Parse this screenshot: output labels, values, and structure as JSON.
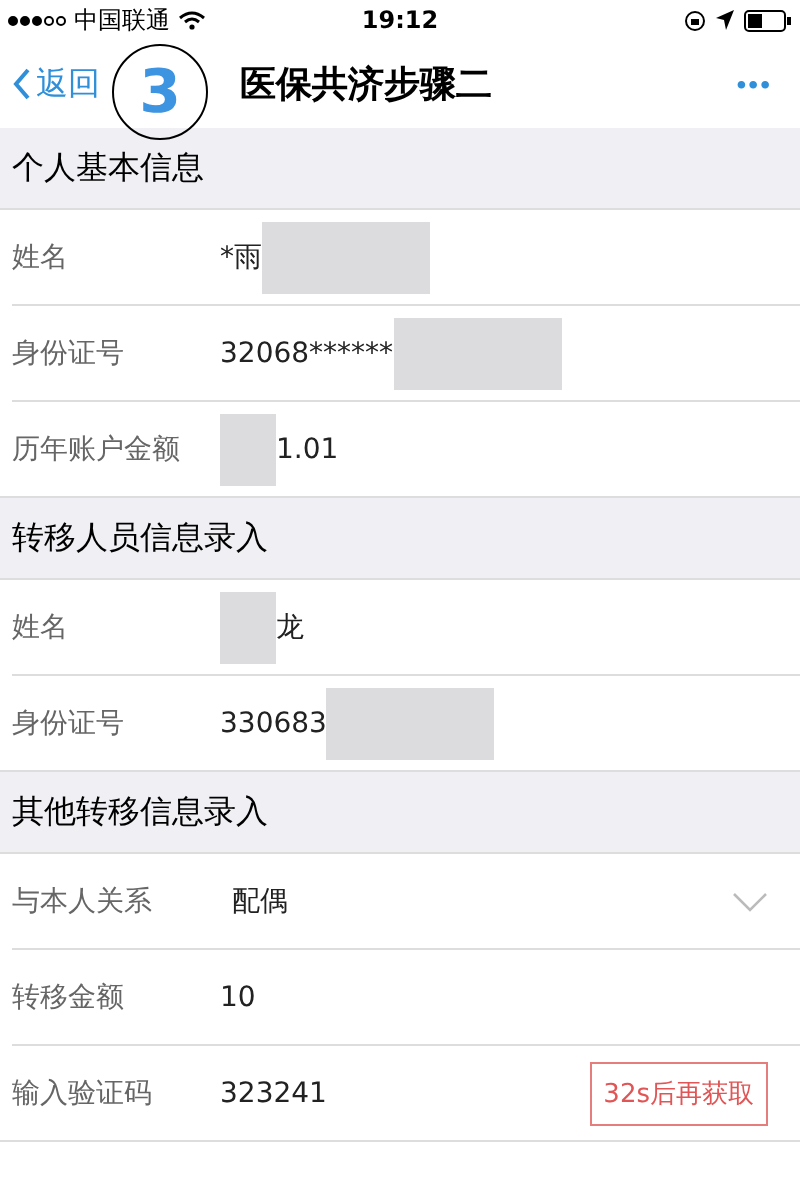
{
  "status_bar": {
    "carrier": "中国联通",
    "time": "19:12"
  },
  "nav": {
    "back": "返回",
    "title": "医保共济步骤二",
    "more": "•••"
  },
  "step_badge": "3",
  "sections": [
    {
      "title": "个人基本信息",
      "rows": [
        {
          "label": "姓名",
          "kind": "text",
          "value": "*雨",
          "mask_after": true
        },
        {
          "label": "身份证号",
          "kind": "text",
          "value": "32068******",
          "mask_after": true
        },
        {
          "label": "历年账户金额",
          "kind": "text",
          "value": "1.01",
          "mask_before": true
        }
      ]
    },
    {
      "title": "转移人员信息录入",
      "rows": [
        {
          "label": "姓名",
          "kind": "text",
          "value": "龙",
          "mask_before": true
        },
        {
          "label": "身份证号",
          "kind": "text",
          "value": "330683",
          "mask_after": true
        }
      ]
    },
    {
      "title": "其他转移信息录入",
      "rows": [
        {
          "label": "与本人关系",
          "kind": "select",
          "value": "配偶"
        },
        {
          "label": "转移金额",
          "kind": "text",
          "value": "10"
        },
        {
          "label": "输入验证码",
          "kind": "code",
          "value": "323241",
          "button": "32s后再获取"
        }
      ]
    }
  ]
}
